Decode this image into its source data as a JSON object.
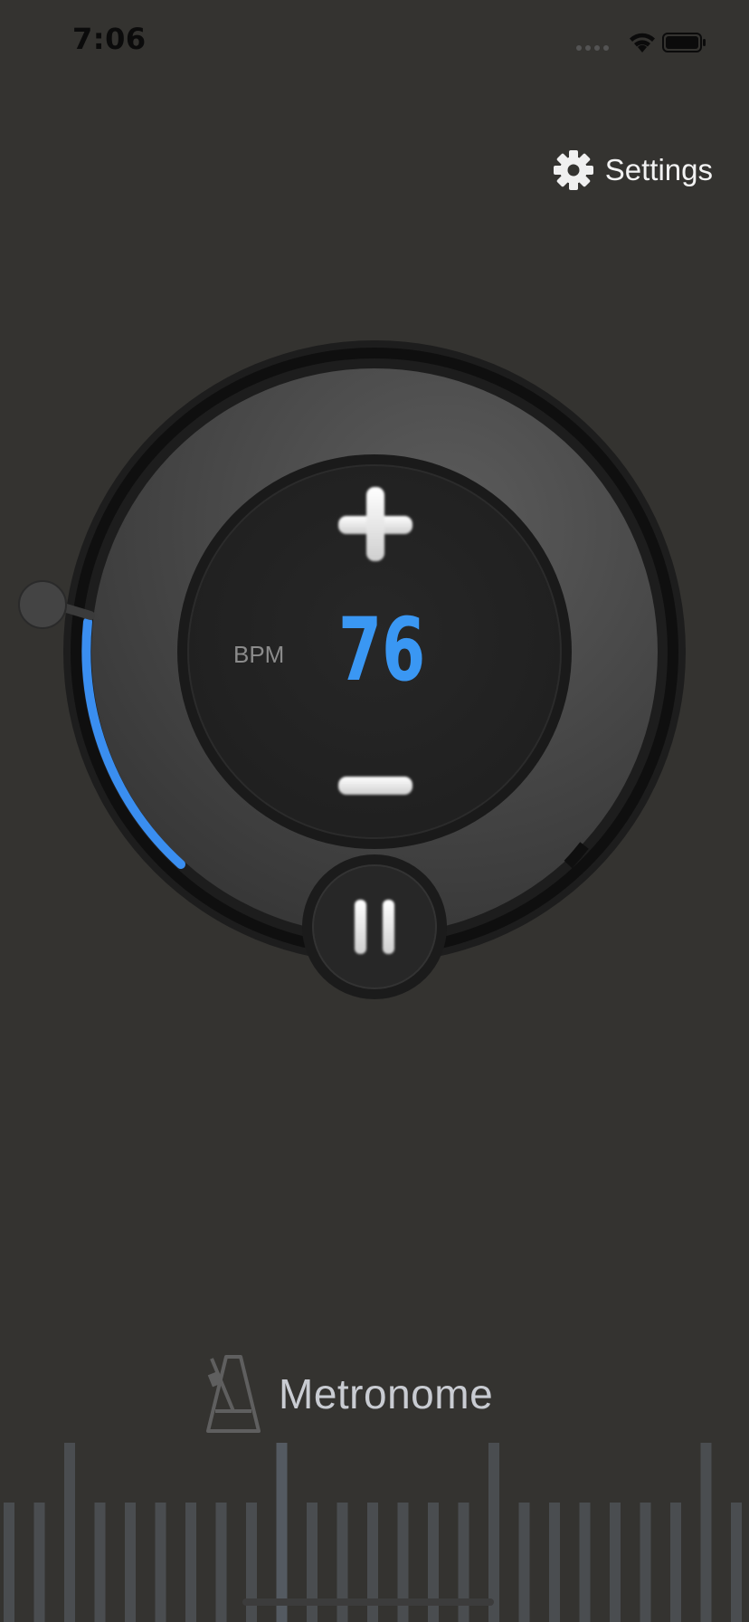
{
  "status_bar": {
    "time": "7:06",
    "icons": [
      "signal-dots-icon",
      "wifi-icon",
      "battery-icon"
    ]
  },
  "header": {
    "settings_label": "Settings",
    "settings_icon": "gear-icon"
  },
  "metronome": {
    "bpm_label": "BPM",
    "bpm_value": "76",
    "tempo_fraction": 0.18,
    "accent_color": "#3a97f3",
    "state_icon": "pause-icon",
    "increase_icon": "plus-icon",
    "decrease_icon": "minus-icon"
  },
  "footer": {
    "app_name": "Metronome",
    "logo_icon": "metronome-icon"
  }
}
